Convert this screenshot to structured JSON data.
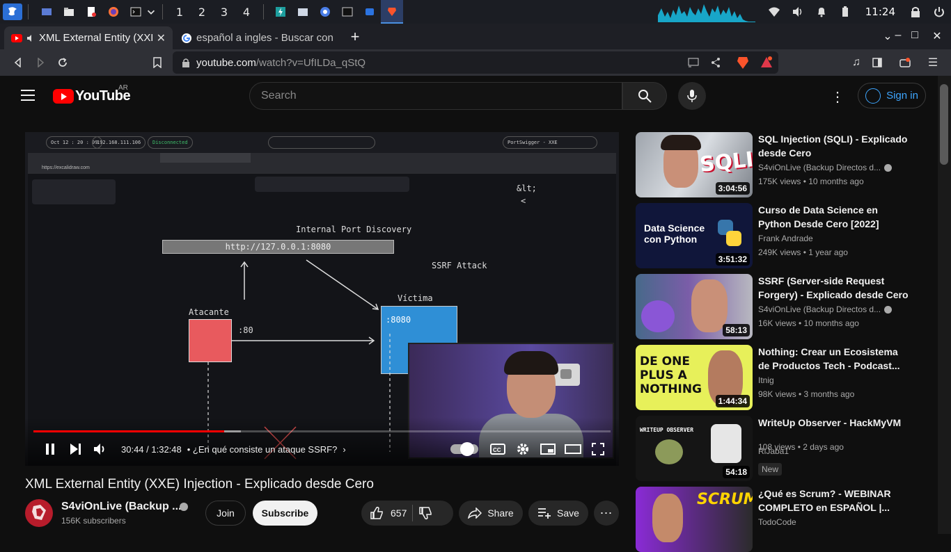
{
  "taskbar": {
    "workspaces": [
      "1",
      "2",
      "3",
      "4"
    ],
    "clock": "11:24"
  },
  "browser": {
    "tabs": [
      {
        "title": "XML External Entity (XXE) Injection",
        "active": true
      },
      {
        "title": "español a ingles - Buscar con Google",
        "active": false
      }
    ],
    "url_domain": "youtube.com",
    "url_path": "/watch?v=UfILDa_qStQ"
  },
  "youtube": {
    "logo_word": "YouTube",
    "region": "AR",
    "search_placeholder": "Search",
    "signin_label": "Sign in"
  },
  "video": {
    "time": "30:44 / 1:32:48",
    "chapter": "• ¿En qué consiste un ataque SSRF?",
    "progress": 0.331,
    "loaded": 0.36,
    "title": "XML External Entity (XXE) Injection - Explicado desde Cero",
    "overlay": {
      "date": "Oct 12 : 20 : 09",
      "ip": "192.168.111.106",
      "status": "Disconnected",
      "target": "PortSwigger - XXE",
      "excalidraw_url": "https://excalidraw.com",
      "heading": "Internal Port Discovery",
      "box_url": "http://127.0.0.1:8080",
      "attack": "SSRF Attack",
      "attacker": "Atacante",
      "victim": "Víctima",
      "port80": ":80",
      "port8080": ":8080",
      "lt": "&lt;",
      "lt2": "<"
    }
  },
  "channel": {
    "name": "S4viOnLive (Backup ...",
    "subscribers": "156K subscribers",
    "join_label": "Join",
    "subscribe_label": "Subscribe"
  },
  "actions": {
    "likes": "657",
    "share_label": "Share",
    "save_label": "Save"
  },
  "sidebar": [
    {
      "title": "SQL Injection (SQLI) - Explicado desde Cero",
      "channel": "S4viOnLive (Backup Directos d...",
      "meta": "175K views  •  10 months ago",
      "duration": "3:04:56",
      "verified": true,
      "thumb_text": "SQLI"
    },
    {
      "title": "Curso de Data Science en Python Desde Cero [2022]",
      "channel": "Frank Andrade",
      "meta": "249K views  •  1 year ago",
      "duration": "3:51:32",
      "verified": false,
      "thumb_text": "Data Science con Python"
    },
    {
      "title": "SSRF (Server-side Request Forgery) - Explicado desde Cero",
      "channel": "S4viOnLive (Backup Directos d...",
      "meta": "16K views  •  10 months ago",
      "duration": "58:13",
      "verified": true,
      "thumb_text": ""
    },
    {
      "title": "Nothing: Crear un Ecosistema de Productos Tech - Podcast...",
      "channel": "Itnig",
      "meta": "98K views  •  3 months ago",
      "duration": "1:44:34",
      "verified": false,
      "thumb_text": "DE ONE PLUS A NOTHING"
    },
    {
      "title": "WriteUp Observer - HackMyVM",
      "channel": "RiJaba1",
      "meta": "108 views  •  2 days ago",
      "duration": "54:18",
      "verified": false,
      "badge": "New",
      "thumb_text": "WRITEUP OBSERVER"
    },
    {
      "title": "¿Qué es Scrum? - WEBINAR COMPLETO en ESPAÑOL |...",
      "channel": "TodoCode",
      "meta": "",
      "duration": "",
      "verified": false,
      "thumb_text": "SCRUM"
    }
  ],
  "colors": {
    "accent_red": "#ff0000",
    "link_blue": "#3ea6ff",
    "bg": "#0f0f0f"
  }
}
